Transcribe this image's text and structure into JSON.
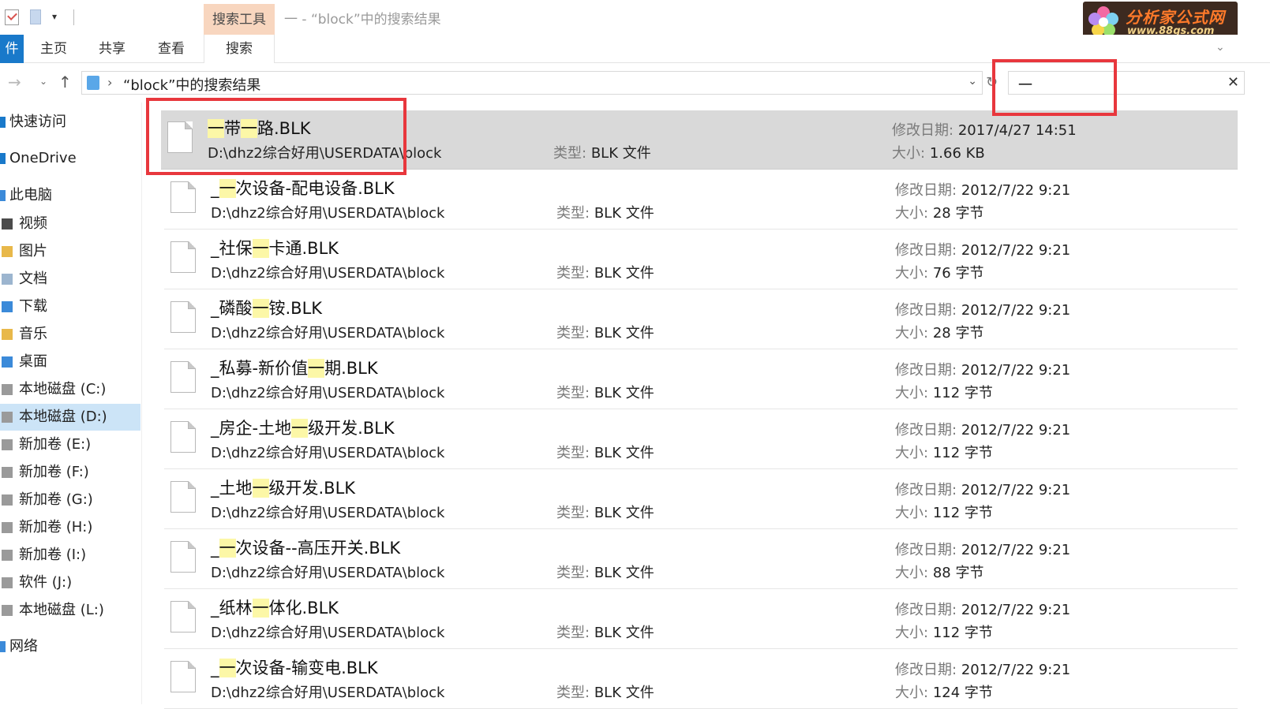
{
  "window": {
    "title": "一 - “block”中的搜索结果",
    "context_group": "搜索工具",
    "logo_text": "分析家公式网",
    "logo_url": "www.88gs.com"
  },
  "ribbon": {
    "file_tab": "件",
    "tabs": [
      "主页",
      "共享",
      "查看"
    ],
    "search_tab": "搜索"
  },
  "address": {
    "path": "“block”中的搜索结果"
  },
  "search": {
    "value": "一"
  },
  "sidebar": {
    "items": [
      {
        "label": "快速访问",
        "icon": "star-icon"
      },
      {
        "label": "OneDrive",
        "icon": "cloud-icon"
      },
      {
        "label": "此电脑",
        "icon": "computer-icon"
      },
      {
        "label": "视频",
        "icon": "video-folder-icon"
      },
      {
        "label": "图片",
        "icon": "pictures-folder-icon"
      },
      {
        "label": "文档",
        "icon": "documents-folder-icon"
      },
      {
        "label": "下载",
        "icon": "downloads-folder-icon"
      },
      {
        "label": "音乐",
        "icon": "music-folder-icon"
      },
      {
        "label": "桌面",
        "icon": "desktop-folder-icon"
      },
      {
        "label": "本地磁盘 (C:)",
        "icon": "drive-icon"
      },
      {
        "label": "本地磁盘 (D:)",
        "icon": "drive-icon",
        "selected": true
      },
      {
        "label": "新加卷 (E:)",
        "icon": "drive-icon"
      },
      {
        "label": "新加卷 (F:)",
        "icon": "drive-icon"
      },
      {
        "label": "新加卷 (G:)",
        "icon": "drive-icon"
      },
      {
        "label": "新加卷 (H:)",
        "icon": "drive-icon"
      },
      {
        "label": "新加卷 (I:)",
        "icon": "drive-icon"
      },
      {
        "label": "软件 (J:)",
        "icon": "drive-icon"
      },
      {
        "label": "本地磁盘 (L:)",
        "icon": "drive-icon"
      },
      {
        "label": "网络",
        "icon": "network-icon"
      }
    ]
  },
  "labels": {
    "type": "类型:",
    "modified": "修改日期:",
    "size": "大小:"
  },
  "files": [
    {
      "name": "一带一路.BLK",
      "path": "D:\\dhz2综合好用\\USERDATA\\block",
      "type": "BLK 文件",
      "modified": "2017/4/27 14:51",
      "size": "1.66 KB",
      "selected": true
    },
    {
      "name": "_一次设备-配电设备.BLK",
      "path": "D:\\dhz2综合好用\\USERDATA\\block",
      "type": "BLK 文件",
      "modified": "2012/7/22 9:21",
      "size": "28 字节"
    },
    {
      "name": "_社保一卡通.BLK",
      "path": "D:\\dhz2综合好用\\USERDATA\\block",
      "type": "BLK 文件",
      "modified": "2012/7/22 9:21",
      "size": "76 字节"
    },
    {
      "name": "_磷酸一铵.BLK",
      "path": "D:\\dhz2综合好用\\USERDATA\\block",
      "type": "BLK 文件",
      "modified": "2012/7/22 9:21",
      "size": "28 字节"
    },
    {
      "name": "_私募-新价值一期.BLK",
      "path": "D:\\dhz2综合好用\\USERDATA\\block",
      "type": "BLK 文件",
      "modified": "2012/7/22 9:21",
      "size": "112 字节"
    },
    {
      "name": "_房企-土地一级开发.BLK",
      "path": "D:\\dhz2综合好用\\USERDATA\\block",
      "type": "BLK 文件",
      "modified": "2012/7/22 9:21",
      "size": "112 字节"
    },
    {
      "name": "_土地一级开发.BLK",
      "path": "D:\\dhz2综合好用\\USERDATA\\block",
      "type": "BLK 文件",
      "modified": "2012/7/22 9:21",
      "size": "112 字节"
    },
    {
      "name": "_一次设备--高压开关.BLK",
      "path": "D:\\dhz2综合好用\\USERDATA\\block",
      "type": "BLK 文件",
      "modified": "2012/7/22 9:21",
      "size": "88 字节"
    },
    {
      "name": "_纸林一体化.BLK",
      "path": "D:\\dhz2综合好用\\USERDATA\\block",
      "type": "BLK 文件",
      "modified": "2012/7/22 9:21",
      "size": "112 字节"
    },
    {
      "name": "_一次设备-输变电.BLK",
      "path": "D:\\dhz2综合好用\\USERDATA\\block",
      "type": "BLK 文件",
      "modified": "2012/7/22 9:21",
      "size": "124 字节"
    }
  ],
  "colors": {
    "accent": "#1979ca",
    "context_tab": "#f8d6bf",
    "selected_row": "#d9d9d9",
    "match_highlight": "#fcf7a7",
    "annotation_box": "#e8373d"
  }
}
